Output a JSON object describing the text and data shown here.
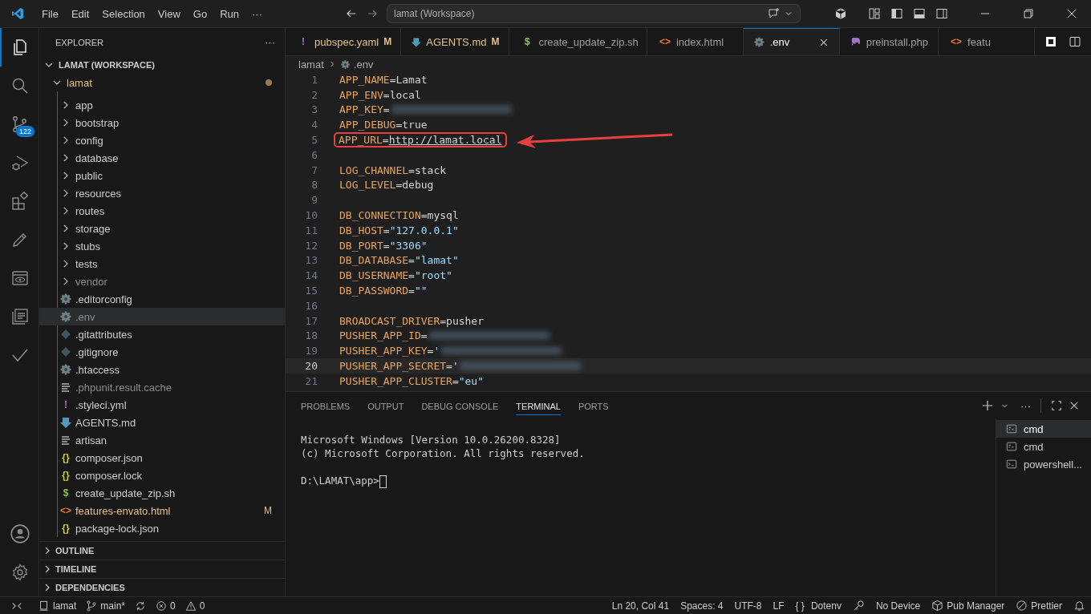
{
  "titlebar": {
    "menus": [
      "File",
      "Edit",
      "Selection",
      "View",
      "Go",
      "Run",
      "···"
    ],
    "command_center": "lamat (Workspace)"
  },
  "activity_bar": {
    "top": [
      {
        "kind": "explorer",
        "selected": true
      },
      {
        "kind": "search",
        "selected": false
      },
      {
        "kind": "source-control",
        "selected": false,
        "badge": "122"
      },
      {
        "kind": "run-debug",
        "selected": false
      },
      {
        "kind": "extensions",
        "selected": false
      },
      {
        "kind": "pencil",
        "selected": false
      },
      {
        "kind": "eye",
        "selected": false
      },
      {
        "kind": "notebook",
        "selected": false
      },
      {
        "kind": "check",
        "selected": false
      }
    ],
    "bottom": [
      {
        "kind": "account"
      },
      {
        "kind": "settings"
      }
    ]
  },
  "sidebar": {
    "title": "EXPLORER",
    "more": "···",
    "tree": [
      {
        "label": "LAMAT (WORKSPACE)",
        "expanded": true,
        "children": [
          {
            "label": "lamat",
            "expanded": true,
            "modified": true,
            "children": [
              {
                "label": "app",
                "kind": "folder",
                "expanded": false,
                "dimmed": false,
                "selected": false
              },
              {
                "label": "bootstrap",
                "kind": "folder",
                "expanded": false,
                "dimmed": false,
                "selected": false
              },
              {
                "label": "config",
                "kind": "folder",
                "expanded": false,
                "dimmed": false,
                "selected": false
              },
              {
                "label": "database",
                "kind": "folder",
                "expanded": false,
                "dimmed": false,
                "selected": false
              },
              {
                "label": "public",
                "kind": "folder",
                "expanded": false,
                "dimmed": false,
                "selected": false
              },
              {
                "label": "resources",
                "kind": "folder",
                "expanded": false,
                "dimmed": false,
                "selected": false
              },
              {
                "label": "routes",
                "kind": "folder",
                "expanded": false,
                "dimmed": false,
                "selected": false
              },
              {
                "label": "storage",
                "kind": "folder",
                "expanded": false,
                "dimmed": false,
                "selected": false
              },
              {
                "label": "stubs",
                "kind": "folder",
                "expanded": false,
                "dimmed": false,
                "selected": false
              },
              {
                "label": "tests",
                "kind": "folder",
                "expanded": false,
                "dimmed": false,
                "selected": false
              },
              {
                "label": "vendor",
                "kind": "folder",
                "expanded": false,
                "dimmed": true,
                "selected": false
              },
              {
                "label": ".editorconfig",
                "kind": "gear",
                "dimmed": false,
                "selected": false
              },
              {
                "label": ".env",
                "kind": "gear",
                "dimmed": true,
                "selected": true
              },
              {
                "label": ".gitattributes",
                "kind": "git",
                "dimmed": false,
                "selected": false
              },
              {
                "label": ".gitignore",
                "kind": "git",
                "dimmed": false,
                "selected": false
              },
              {
                "label": ".htaccess",
                "kind": "gear",
                "dimmed": false,
                "selected": false
              },
              {
                "label": ".phpunit.result.cache",
                "kind": "lines",
                "dimmed": true,
                "selected": false
              },
              {
                "label": ".styleci.yml",
                "kind": "yaml",
                "icon": "!",
                "dimmed": false,
                "selected": false
              },
              {
                "label": "AGENTS.md",
                "kind": "md",
                "dimmed": false,
                "selected": false
              },
              {
                "label": "artisan",
                "kind": "lines",
                "dimmed": false,
                "selected": false
              },
              {
                "label": "composer.json",
                "kind": "json",
                "icon": "{}",
                "dimmed": false,
                "selected": false
              },
              {
                "label": "composer.lock",
                "kind": "json",
                "icon": "{}",
                "dimmed": false,
                "selected": false
              },
              {
                "label": "create_update_zip.sh",
                "kind": "sh",
                "icon": "$",
                "dimmed": false,
                "selected": false
              },
              {
                "label": "features-envato.html",
                "kind": "html",
                "icon": "<>",
                "badge": "M",
                "dimmed": false,
                "selected": false
              },
              {
                "label": "package-lock.json",
                "kind": "json",
                "icon": "{}",
                "dimmed": false,
                "selected": false
              }
            ]
          }
        ]
      }
    ],
    "sections": [
      {
        "label": "OUTLINE",
        "expanded": false
      },
      {
        "label": "TIMELINE",
        "expanded": false
      },
      {
        "label": "DEPENDENCIES",
        "expanded": false
      }
    ]
  },
  "tabs": [
    {
      "label": "pubspec.yaml",
      "kind": "yaml",
      "icon": "!",
      "badge": "M",
      "selected": false
    },
    {
      "label": "AGENTS.md",
      "kind": "md",
      "badge": "M",
      "selected": false
    },
    {
      "label": "create_update_zip.sh",
      "kind": "sh",
      "icon": "$",
      "selected": false
    },
    {
      "label": "index.html",
      "kind": "html",
      "icon": "<>",
      "selected": false
    },
    {
      "label": ".env",
      "kind": "gear",
      "selected": true
    },
    {
      "label": "preinstall.php",
      "kind": "php",
      "selected": false
    },
    {
      "label": "featu",
      "kind": "html",
      "icon": "<>",
      "selected": false
    }
  ],
  "breadcrumb": [
    "lamat",
    ".env"
  ],
  "code": [
    {
      "n": "1",
      "key": "APP_NAME",
      "eq": "=",
      "value": "Lamat",
      "kind": "plain"
    },
    {
      "n": "2",
      "key": "APP_ENV",
      "eq": "=",
      "value": "local",
      "kind": "plain"
    },
    {
      "n": "3",
      "key": "APP_KEY",
      "eq": "=",
      "redacted": true
    },
    {
      "n": "4",
      "key": "APP_DEBUG",
      "eq": "=",
      "value": "true",
      "kind": "plain"
    },
    {
      "n": "5",
      "key": "APP_URL",
      "eq": "=",
      "value": "http://lamat.local",
      "kind": "link",
      "highlighted": true
    },
    {
      "n": "6"
    },
    {
      "n": "7",
      "key": "LOG_CHANNEL",
      "eq": "=",
      "value": "stack",
      "kind": "plain"
    },
    {
      "n": "8",
      "key": "LOG_LEVEL",
      "eq": "=",
      "value": "debug",
      "kind": "plain"
    },
    {
      "n": "9"
    },
    {
      "n": "10",
      "key": "DB_CONNECTION",
      "eq": "=",
      "value": "mysql",
      "kind": "plain"
    },
    {
      "n": "11",
      "key": "DB_HOST",
      "eq": "=",
      "value": "\"127.0.0.1\"",
      "kind": "string"
    },
    {
      "n": "12",
      "key": "DB_PORT",
      "eq": "=",
      "value": "\"3306\"",
      "kind": "string"
    },
    {
      "n": "13",
      "key": "DB_DATABASE",
      "eq": "=",
      "value": "\"lamat\"",
      "kind": "string"
    },
    {
      "n": "14",
      "key": "DB_USERNAME",
      "eq": "=",
      "value": "\"root\"",
      "kind": "string"
    },
    {
      "n": "15",
      "key": "DB_PASSWORD",
      "eq": "=",
      "value": "\"\"",
      "kind": "string"
    },
    {
      "n": "16"
    },
    {
      "n": "17",
      "key": "BROADCAST_DRIVER",
      "eq": "=",
      "value": "pusher",
      "kind": "plain"
    },
    {
      "n": "18",
      "key": "PUSHER_APP_ID",
      "eq": "=",
      "redacted": true
    },
    {
      "n": "19",
      "key": "PUSHER_APP_KEY",
      "eq": "=",
      "value": "'",
      "kind": "string",
      "redacted": true
    },
    {
      "n": "20",
      "key": "PUSHER_APP_SECRET",
      "eq": "=",
      "value": "'",
      "kind": "string",
      "redacted": true,
      "current": true
    },
    {
      "n": "21",
      "key": "PUSHER_APP_CLUSTER",
      "eq": "=",
      "value": "\"eu\"",
      "kind": "string"
    }
  ],
  "panel": {
    "tabs": [
      {
        "label": "PROBLEMS",
        "selected": false
      },
      {
        "label": "OUTPUT",
        "selected": false
      },
      {
        "label": "DEBUG CONSOLE",
        "selected": false
      },
      {
        "label": "TERMINAL",
        "selected": true
      },
      {
        "label": "PORTS",
        "selected": false
      }
    ],
    "more": "···",
    "terminal_header": [
      "Microsoft Windows [Version 10.0.26200.8328]",
      "(c) Microsoft Corporation. All rights reserved."
    ],
    "terminal_prompt": "D:\\LAMAT\\app>",
    "terminals": [
      {
        "label": "cmd",
        "kind": "cmd",
        "selected": true
      },
      {
        "label": "cmd",
        "kind": "cmd",
        "selected": false
      },
      {
        "label": "powershell...",
        "kind": "powershell",
        "selected": false
      }
    ]
  },
  "status_bar": {
    "left": [
      {
        "kind": "remote"
      },
      {
        "kind": "folder",
        "label": "lamat"
      },
      {
        "kind": "branch",
        "label": "main*"
      },
      {
        "kind": "sync"
      },
      {
        "kind": "error",
        "label": "0"
      },
      {
        "kind": "warning",
        "label": "0"
      }
    ],
    "right": [
      {
        "label": "Ln 20, Col 41"
      },
      {
        "label": "Spaces: 4"
      },
      {
        "label": "UTF-8"
      },
      {
        "label": "LF"
      },
      {
        "kind": "braces",
        "icon": "{ }",
        "label": "Dotenv"
      },
      {
        "kind": "key"
      },
      {
        "label": "No Device"
      },
      {
        "kind": "package",
        "label": "Pub Manager"
      },
      {
        "kind": "prohibited",
        "label": "Prettier"
      },
      {
        "kind": "bell"
      }
    ]
  }
}
